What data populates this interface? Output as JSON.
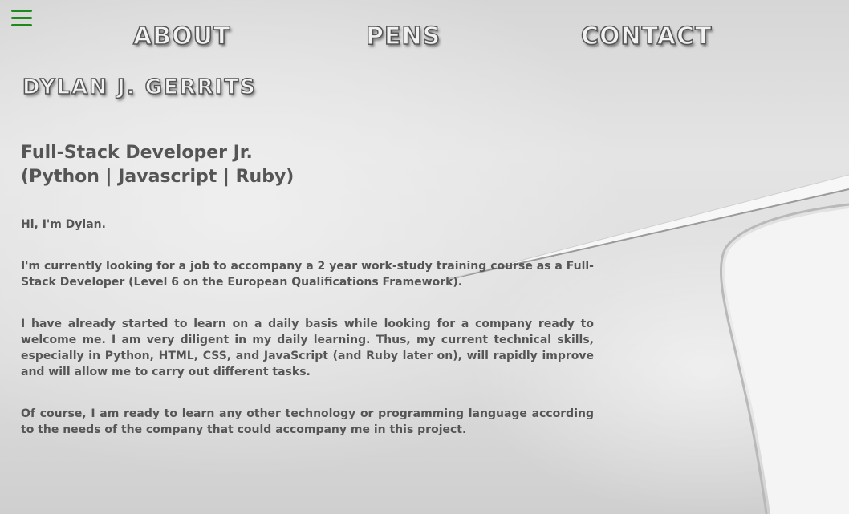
{
  "nav": {
    "menu_icon": "hamburger-menu-icon",
    "menu_color": "#1e8a1e",
    "items": [
      {
        "label": "ABOUT"
      },
      {
        "label": "PENS"
      },
      {
        "label": "CONTACT"
      }
    ]
  },
  "brand": {
    "name": "DYLAN J. GERRITS"
  },
  "headline": {
    "line1": "Full-Stack Developer Jr.",
    "line2": "(Python | Javascript | Ruby)"
  },
  "about": {
    "paragraphs": [
      "Hi, I'm Dylan.",
      "I'm currently looking for a job to accompany a 2 year work-study training course as a Full-Stack Developer (Level 6 on the European Qualifications Framework).",
      "I have already started to learn on a daily basis while looking for a company ready to welcome me. I am very diligent in my daily learning. Thus, my current technical skills, especially in Python, HTML, CSS, and JavaScript (and Ruby later on), will rapidly improve and will allow me to carry out different tasks.",
      "Of course, I am ready to learn any other technology or programming language according to the needs of the company that could accompany me in this project."
    ]
  }
}
